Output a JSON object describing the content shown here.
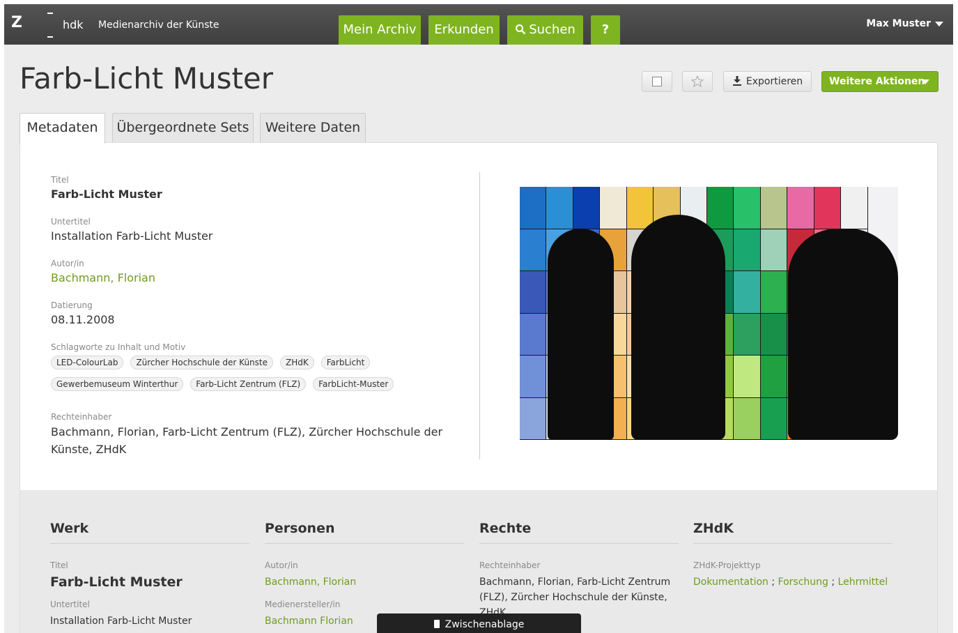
{
  "topbar": {
    "logo": "Z",
    "brand": "hdk",
    "app_title": "Medienarchiv der Künste",
    "nav": [
      {
        "label": "Mein Archiv"
      },
      {
        "label": "Erkunden"
      },
      {
        "label": "Suchen"
      },
      {
        "label": "?"
      }
    ],
    "user": "Max Muster"
  },
  "page": {
    "title": "Farb-Licht Muster",
    "export_label": "Exportieren",
    "more_actions_label": "Weitere Aktionen"
  },
  "tabs": [
    {
      "label": "Metadaten",
      "active": true
    },
    {
      "label": "Übergeordnete Sets",
      "active": false
    },
    {
      "label": "Weitere Daten",
      "active": false
    }
  ],
  "metadata": {
    "titel_label": "Titel",
    "titel": "Farb-Licht Muster",
    "untertitel_label": "Untertitel",
    "untertitel": "Installation Farb-Licht Muster",
    "autor_label": "Autor/in",
    "autor": "Bachmann, Florian",
    "datierung_label": "Datierung",
    "datierung": "08.11.2008",
    "schlagworte_label": "Schlagworte zu Inhalt und Motiv",
    "schlagworte": [
      "LED-ColourLab",
      "Zürcher Hochschule der Künste",
      "ZHdK",
      "FarbLicht",
      "Gewerbemuseum Winterthur",
      "Farb-Licht Zentrum (FLZ)",
      "FarbLicht-Muster"
    ],
    "rechteinhaber_label": "Rechteinhaber",
    "rechteinhaber": "Bachmann, Florian, Farb-Licht Zentrum (FLZ), Zürcher Hochschule der Künste, ZHdK"
  },
  "lower": {
    "werk": {
      "heading": "Werk",
      "titel_label": "Titel",
      "titel": "Farb-Licht Muster",
      "untertitel_label": "Untertitel",
      "untertitel": "Installation Farb-Licht Muster"
    },
    "personen": {
      "heading": "Personen",
      "autor_label": "Autor/in",
      "autor": "Bachmann, Florian",
      "medienersteller_label": "Medienersteller/in",
      "medienersteller": "Bachmann Florian"
    },
    "rechte": {
      "heading": "Rechte",
      "rechteinhaber_label": "Rechteinhaber",
      "rechteinhaber": "Bachmann, Florian, Farb-Licht Zentrum (FLZ), Zürcher Hochschule der Künste, ZHdK"
    },
    "zhdk": {
      "heading": "ZHdK",
      "projekttyp_label": "ZHdK-Projekttyp",
      "projekttypen": [
        "Dokumentation",
        "Forschung",
        "Lehrmittel"
      ]
    }
  },
  "clipboard": {
    "label": "Zwischenablage"
  },
  "colors": {
    "accent": "#7fb421",
    "link": "#6f9c1e",
    "topbar": "#4a4a4a"
  }
}
